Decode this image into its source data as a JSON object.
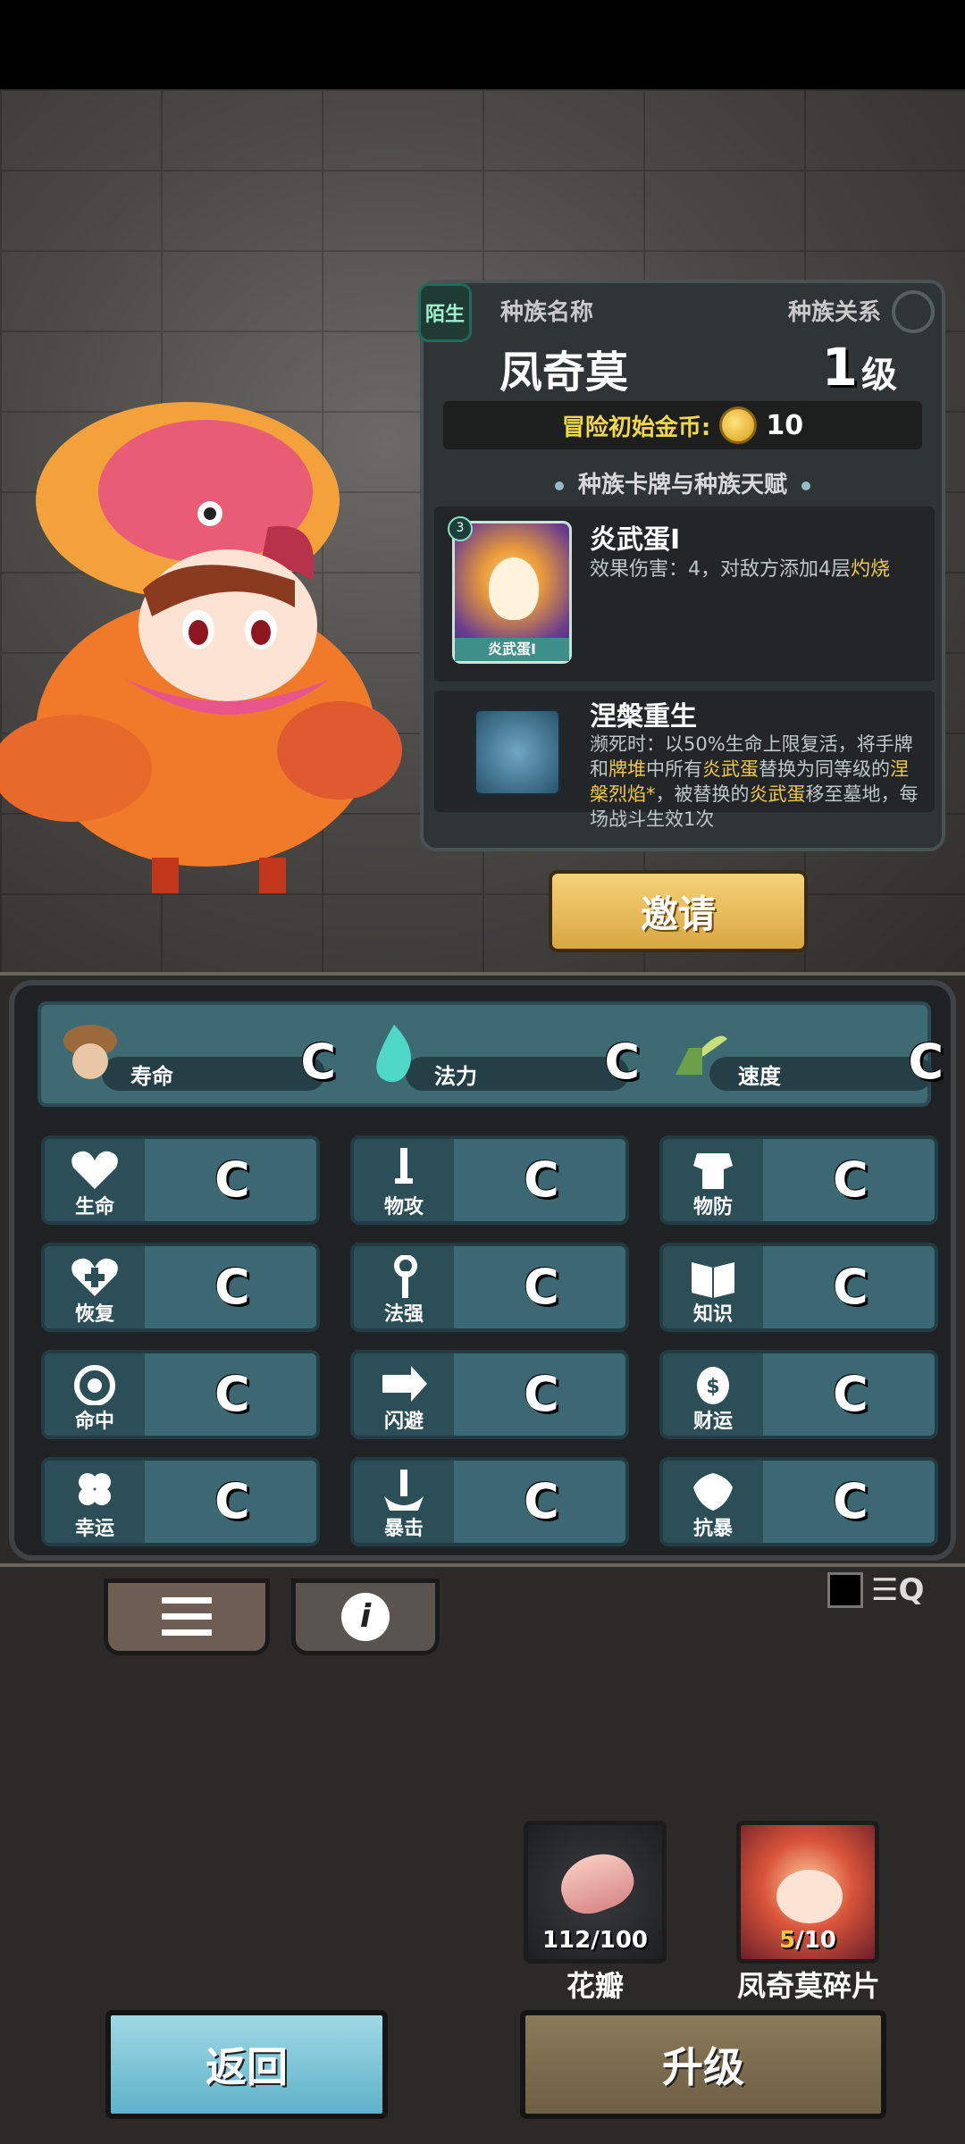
{
  "info": {
    "tag": "陌生",
    "race_name_label": "种族名称",
    "race_relation_label": "种族关系",
    "race_name": "凤奇莫",
    "level_value": "1",
    "level_unit": "级",
    "starting_gold_label": "冒险初始金币:",
    "starting_gold_value": "10",
    "section_title": "种族卡牌与种族天赋",
    "card": {
      "level": "3",
      "image_caption": "炎武蛋I",
      "title": "炎武蛋I",
      "desc_prefix": "效果伤害：4，对敌方添加4层",
      "desc_highlight": "灼烧"
    },
    "talent": {
      "title": "涅槃重生",
      "desc_1": "濒死时：以50%生命上限复活，将手牌和",
      "desc_hl_1": "牌堆",
      "desc_2": "中所有",
      "desc_hl_2": "炎武蛋",
      "desc_3": "替换为同等级的",
      "desc_hl_3": "涅槃烈焰*",
      "desc_4": "，被替换的",
      "desc_hl_4": "炎武蛋",
      "desc_5": "移至墓地，每场战斗生效1次"
    },
    "invite_label": "邀请"
  },
  "main_stats": [
    {
      "name": "寿命",
      "grade": "C",
      "icon": "mushroom-head-icon"
    },
    {
      "name": "法力",
      "grade": "C",
      "icon": "blue-flame-icon"
    },
    {
      "name": "速度",
      "grade": "C",
      "icon": "winged-boot-icon"
    }
  ],
  "stats": [
    {
      "name": "生命",
      "grade": "C",
      "icon": "heart-icon"
    },
    {
      "name": "物攻",
      "grade": "C",
      "icon": "sword-icon"
    },
    {
      "name": "物防",
      "grade": "C",
      "icon": "armor-icon"
    },
    {
      "name": "恢复",
      "grade": "C",
      "icon": "heart-plus-icon"
    },
    {
      "name": "法强",
      "grade": "C",
      "icon": "staff-icon"
    },
    {
      "name": "知识",
      "grade": "C",
      "icon": "book-icon"
    },
    {
      "name": "命中",
      "grade": "C",
      "icon": "target-icon"
    },
    {
      "name": "闪避",
      "grade": "C",
      "icon": "dodge-arrow-icon"
    },
    {
      "name": "财运",
      "grade": "C",
      "icon": "coin-bag-icon"
    },
    {
      "name": "幸运",
      "grade": "C",
      "icon": "clover-icon"
    },
    {
      "name": "暴击",
      "grade": "C",
      "icon": "crit-icon"
    },
    {
      "name": "抗暴",
      "grade": "C",
      "icon": "shield-flower-icon"
    }
  ],
  "tabs": {
    "list_icon": "list-icon",
    "info_icon": "info-icon",
    "info_glyph": "i"
  },
  "filter_glyph": "☰Q",
  "resources": {
    "petal": {
      "name": "花瓣",
      "count": "112/100",
      "icon": "petal-icon"
    },
    "shard": {
      "name": "凤奇莫碎片",
      "count_cur": "5",
      "count_total": "/10",
      "icon": "phoenix-shard-icon"
    }
  },
  "buttons": {
    "back": "返回",
    "upgrade": "升级"
  },
  "colors": {
    "highlight": "#f0c84a",
    "stat_cell": "#3b6873",
    "back_button": "#7cc4d6",
    "upgrade_button": "#7d6c50",
    "invite_button": "#e8bb5a"
  }
}
